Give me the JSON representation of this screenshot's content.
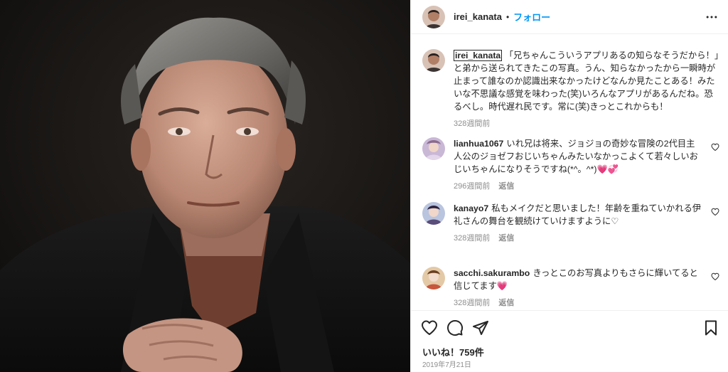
{
  "header": {
    "username": "irei_kanata",
    "dot": "•",
    "follow_label": "フォロー",
    "more_icon": "more-horizontal-icon"
  },
  "caption": {
    "username": "irei_kanata",
    "text": "「兄ちゃんこういうアプリあるの知らなそうだから！」と弟から送られてきたこの写真。うん、知らなかったから一瞬時が止まって誰なのか認識出来なかったけどなんか見たことある！みたいな不思議な感覚を味わった(笑)いろんなアプリがあるんだね。恐るべし。時代遅れ民です。常に(笑)きっとこれからも！",
    "time": "328週間前"
  },
  "comments": [
    {
      "username": "lianhua1067",
      "text": "いれ兄は将来、ジョジョの奇妙な冒険の2代目主人公のジョゼフおじいちゃんみたいなかっこよくて若々しいおじいちゃんになりそうですね(*^。^*)💗💞",
      "time": "296週間前",
      "reply": "返信"
    },
    {
      "username": "kanayo7",
      "text": "私もメイクだと思いました！年齢を重ねていかれる伊礼さんの舞台を観続けていけますように♡",
      "time": "328週間前",
      "reply": "返信"
    },
    {
      "username": "sacchi.sakurambo",
      "text": "きっとこのお写真よりもさらに輝いてると信じてます💗",
      "time": "328週間前",
      "reply": "返信"
    }
  ],
  "actions": {
    "icons": [
      "heart-icon",
      "comment-icon",
      "share-icon",
      "bookmark-icon"
    ],
    "likes": "いいね！759件",
    "date": "2019年7月21日"
  },
  "colors": {
    "accent": "#0095f6",
    "text": "#262626",
    "muted": "#8e8e8e",
    "border": "#efefef"
  }
}
